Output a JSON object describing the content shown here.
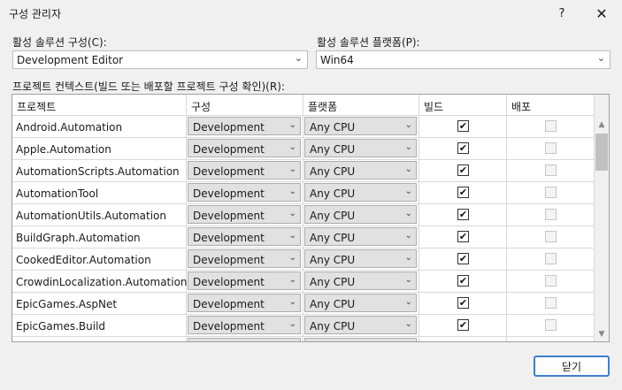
{
  "window": {
    "title": "구성 관리자",
    "help_label": "?",
    "close_label": "✕"
  },
  "active_config": {
    "label": "활성 솔루션 구성(C):",
    "value": "Development Editor"
  },
  "active_platform": {
    "label": "활성 솔루션 플랫폼(P):",
    "value": "Win64"
  },
  "contexts_label": "프로젝트 컨텍스트(빌드 또는 배포할 프로젝트 구성 확인)(R):",
  "table": {
    "headers": [
      "프로젝트",
      "구성",
      "플랫폼",
      "빌드",
      "배포"
    ],
    "rows": [
      {
        "project": "Android.Automation",
        "config": "Development",
        "platform": "Any CPU",
        "build": true,
        "deploy": false
      },
      {
        "project": "Apple.Automation",
        "config": "Development",
        "platform": "Any CPU",
        "build": true,
        "deploy": false
      },
      {
        "project": "AutomationScripts.Automation",
        "config": "Development",
        "platform": "Any CPU",
        "build": true,
        "deploy": false
      },
      {
        "project": "AutomationTool",
        "config": "Development",
        "platform": "Any CPU",
        "build": true,
        "deploy": false
      },
      {
        "project": "AutomationUtils.Automation",
        "config": "Development",
        "platform": "Any CPU",
        "build": true,
        "deploy": false
      },
      {
        "project": "BuildGraph.Automation",
        "config": "Development",
        "platform": "Any CPU",
        "build": true,
        "deploy": false
      },
      {
        "project": "CookedEditor.Automation",
        "config": "Development",
        "platform": "Any CPU",
        "build": true,
        "deploy": false
      },
      {
        "project": "CrowdinLocalization.Automation",
        "config": "Development",
        "platform": "Any CPU",
        "build": true,
        "deploy": false
      },
      {
        "project": "EpicGames.AspNet",
        "config": "Development",
        "platform": "Any CPU",
        "build": true,
        "deploy": false
      },
      {
        "project": "EpicGames.Build",
        "config": "Development",
        "platform": "Any CPU",
        "build": true,
        "deploy": false
      }
    ]
  },
  "close_button": "닫기",
  "icons": {
    "dropdown": "chevron-down-icon",
    "check": "checkmark-icon"
  },
  "colors": {
    "accent": "#3f7fd1",
    "background": "#f0f0f0"
  }
}
